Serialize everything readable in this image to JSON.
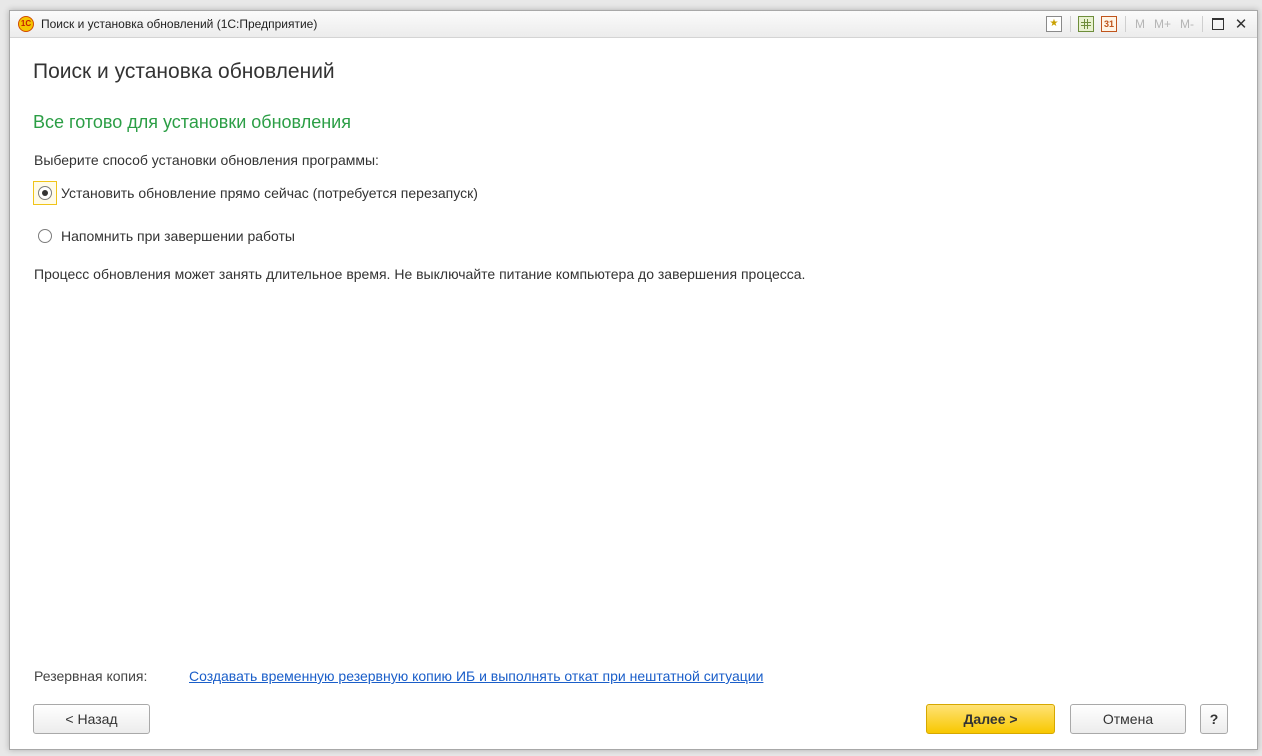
{
  "window": {
    "title": "Поиск и установка обновлений  (1С:Предприятие)",
    "app_logo_text": "1С"
  },
  "toolbar": {
    "mem_m": "M",
    "mem_m_plus": "M+",
    "mem_m_minus": "M-",
    "calendar_day": "31",
    "close_glyph": "✕",
    "star_glyph": "★"
  },
  "form": {
    "title": "Поиск и установка обновлений",
    "section_title": "Все готово для установки обновления",
    "prompt": "Выберите способ установки обновления программы:",
    "options": [
      {
        "label": "Установить обновление прямо сейчас (потребуется перезапуск)",
        "selected": true
      },
      {
        "label": "Напомнить при завершении работы",
        "selected": false
      }
    ],
    "warning": "Процесс обновления может занять длительное время. Не выключайте питание компьютера до завершения процесса.",
    "backup_label": "Резервная копия:",
    "backup_link": "Создавать временную резервную копию ИБ и выполнять откат при нештатной ситуации"
  },
  "buttons": {
    "back": "< Назад",
    "next": "Далее >",
    "cancel": "Отмена",
    "help": "?"
  },
  "colors": {
    "section_title": "#2b9e45",
    "link": "#1a5ec9",
    "primary_button": "#f8c800",
    "focus_border": "#f0c419"
  }
}
